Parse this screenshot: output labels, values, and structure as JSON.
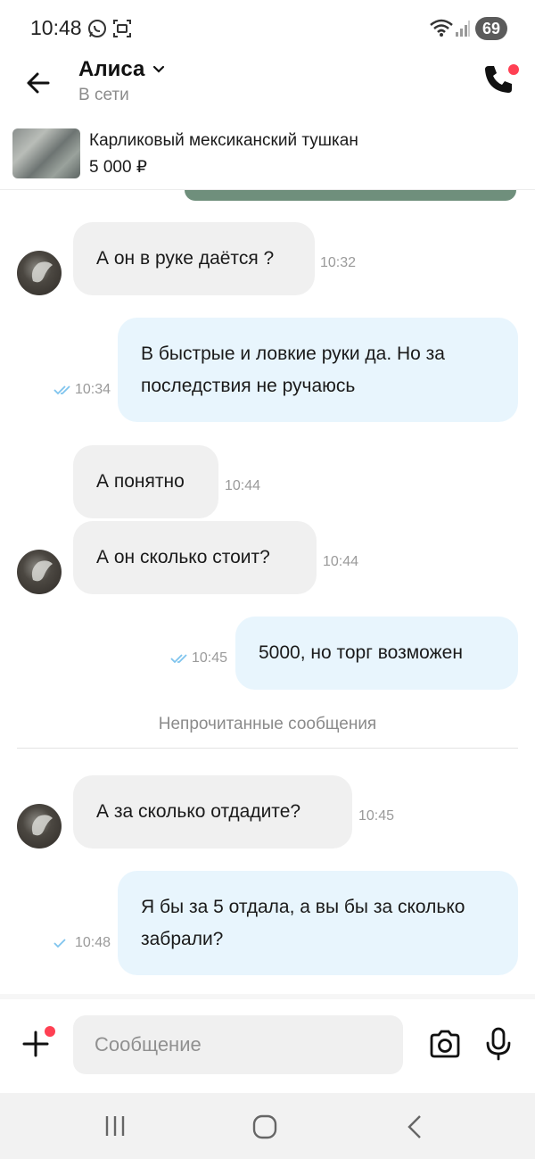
{
  "status_bar": {
    "time": "10:48",
    "battery": "69"
  },
  "header": {
    "name": "Алиса",
    "status": "В сети"
  },
  "item": {
    "title": "Карликовый мексиканский тушкан",
    "price": "5 000 ₽"
  },
  "messages": [
    {
      "dir": "in",
      "text": "А он в руке даётся ?",
      "time": "10:32"
    },
    {
      "dir": "out",
      "text": "В быстрые и ловкие руки да. Но за последствия не ручаюсь",
      "time": "10:34"
    },
    {
      "dir": "in",
      "text": "А понятно",
      "time": "10:44"
    },
    {
      "dir": "in",
      "text": "А он сколько стоит?",
      "time": "10:44"
    },
    {
      "dir": "out",
      "text": "5000, но торг возможен",
      "time": "10:45"
    },
    {
      "dir": "in",
      "text": "А за сколько отдадите?",
      "time": "10:45"
    },
    {
      "dir": "out",
      "text": "Я бы за 5 отдала, а вы бы за сколько забрали?",
      "time": "10:48"
    }
  ],
  "divider": "Непрочитанные сообщения",
  "composer": {
    "placeholder": "Сообщение"
  },
  "colors": {
    "accent": "#ff4053",
    "incoming": "#f0f0f0",
    "outgoing": "#e8f5fd",
    "tick": "#7fc4ee"
  }
}
